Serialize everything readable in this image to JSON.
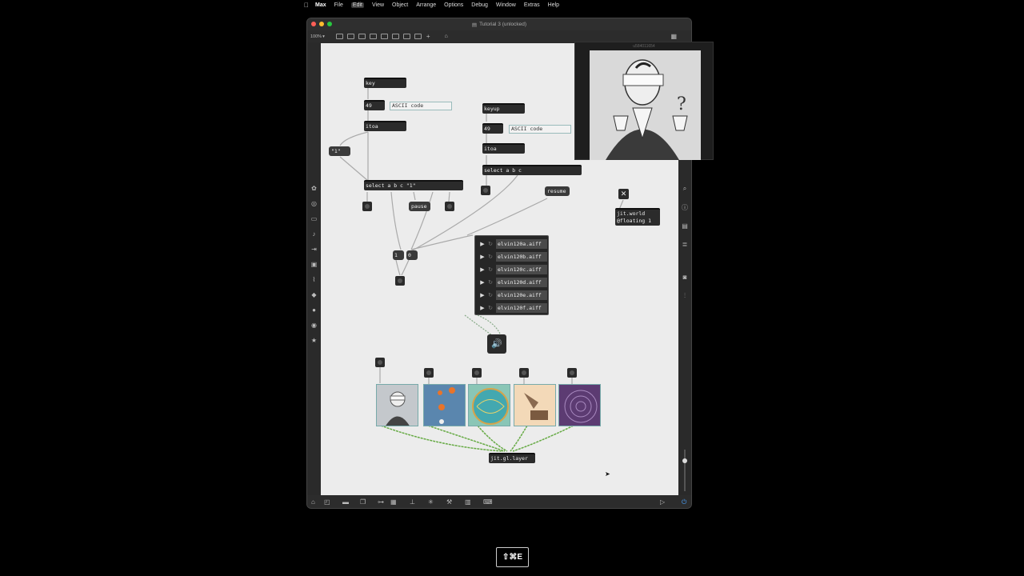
{
  "menubar": {
    "apple": "",
    "items": [
      "Max",
      "File",
      "Edit",
      "View",
      "Object",
      "Arrange",
      "Options",
      "Debug",
      "Window",
      "Extras",
      "Help"
    ],
    "active_index": 2
  },
  "window": {
    "title": "Tutorial 3 (unlocked)",
    "zoom": "100%"
  },
  "patch": {
    "key_obj": "key",
    "key_num": "49",
    "key_comment": "ASCII code",
    "key_itoa": "itoa",
    "msg_1": "\"1\"",
    "select_key": "select a b c \"1\"",
    "msg_pause": "pause",
    "keyup_obj": "keyup",
    "keyup_num": "49",
    "keyup_comment": "ASCII code",
    "keyup_itoa": "itoa",
    "select_keyup": "select a b c",
    "msg_resume": "resume",
    "msg_one": "1",
    "msg_zero": "0",
    "jit_world_line1": "jit.world",
    "jit_world_line2": "@floating 1",
    "jit_gl_layer": "jit.gl.layer",
    "playlist": [
      "elvin120a.aiff",
      "elvin120b.aiff",
      "elvin120c.aiff",
      "elvin120d.aiff",
      "elvin120e.aiff",
      "elvin120f.aiff"
    ]
  },
  "float_window": {
    "title": "u584011654"
  },
  "shortcut": "⇧⌘E"
}
